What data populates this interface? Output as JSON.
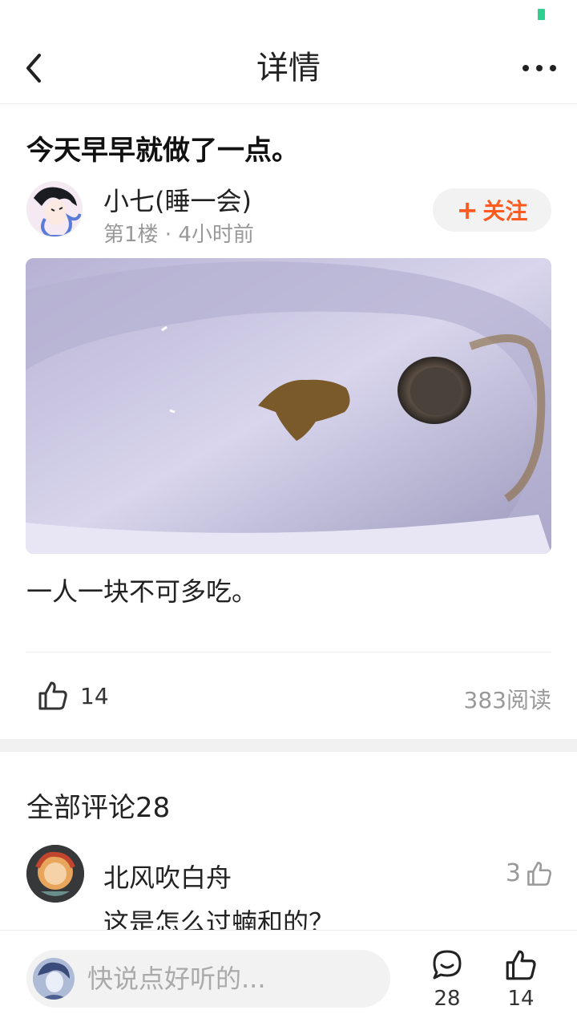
{
  "nav": {
    "title": "详情"
  },
  "post": {
    "title": "今天早早就做了一点。",
    "author": {
      "name": "小七(睡一会)",
      "meta": "第1楼 · 4小时前"
    },
    "follow_plus": "+",
    "follow_label": "关注",
    "body": "一人一块不可多吃。",
    "likes": "14",
    "reads": "383阅读"
  },
  "comments": {
    "header": "全部评论28",
    "items": [
      {
        "name": "北风吹白舟",
        "text": "这是怎么过蝻和的？",
        "likes": "3"
      }
    ]
  },
  "bottom_bar": {
    "placeholder": "快说点好听的...",
    "comment_count": "28",
    "like_count": "14"
  },
  "colors": {
    "accent": "#ff5a1f",
    "battery": "#2ecf8f"
  },
  "icons": [
    "back-icon",
    "more-icon",
    "thumbs-up-icon",
    "comment-icon"
  ]
}
